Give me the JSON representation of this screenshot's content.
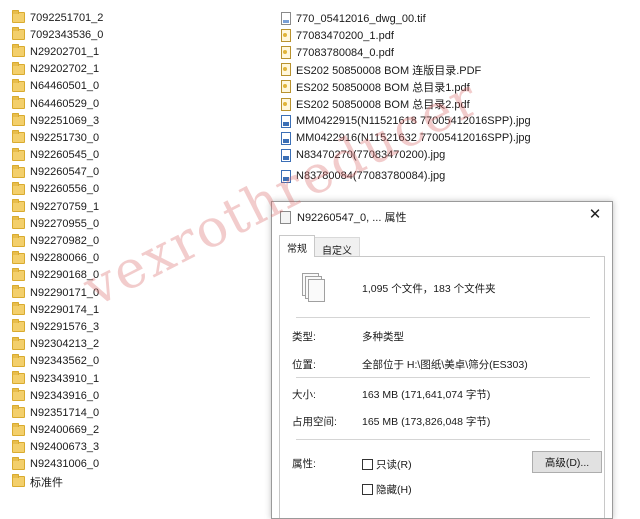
{
  "folders": [
    "7092251701_2",
    "7092343536_0",
    "N29202701_1",
    "N29202702_1",
    "N64460501_0",
    "N64460529_0",
    "N92251069_3",
    "N92251730_0",
    "N92260545_0",
    "N92260547_0",
    "N92260556_0",
    "N92270759_1",
    "N92270955_0",
    "N92270982_0",
    "N92280066_0",
    "N92290168_0",
    "N92290171_0",
    "N92290174_1",
    "N92291576_3",
    "N92304213_2",
    "N92343562_0",
    "N92343910_1",
    "N92343916_0",
    "N92351714_0",
    "N92400669_2",
    "N92400673_3",
    "N92431006_0",
    "标准件"
  ],
  "files": [
    {
      "name": "770_05412016_dwg_00.tif",
      "type": "tif"
    },
    {
      "name": "77083470200_1.pdf",
      "type": "pdf"
    },
    {
      "name": "77083780084_0.pdf",
      "type": "pdf"
    },
    {
      "name": "ES202  50850008 BOM 连版目录.PDF",
      "type": "pdf"
    },
    {
      "name": "ES202  50850008 BOM 总目录1.pdf",
      "type": "pdf"
    },
    {
      "name": "ES202  50850008 BOM 总目录2.pdf",
      "type": "pdf"
    },
    {
      "name": "MM0422915(N11521618 77005412016SPP).jpg",
      "type": "img"
    },
    {
      "name": "MM0422916(N11521632 77005412016SPP).jpg",
      "type": "img"
    },
    {
      "name": "N83470270(77083470200).jpg",
      "type": "img"
    },
    {
      "name": "N83780084(77083780084).jpg",
      "type": "img"
    }
  ],
  "dialog": {
    "title": "N92260547_0, ... 属性",
    "close": "✕",
    "tabs": [
      "常规",
      "自定义"
    ],
    "summary": "1,095 个文件，183 个文件夹",
    "type_label": "类型:",
    "type_value": "多种类型",
    "location_label": "位置:",
    "location_value": "全部位于 H:\\图纸\\美卓\\筛分(ES303)",
    "size_label": "大小:",
    "size_value": "163 MB (171,641,074 字节)",
    "disk_label": "占用空间:",
    "disk_value": "165 MB (173,826,048 字节)",
    "attr_label": "属性:",
    "readonly": "只读(R)",
    "hidden": "隐藏(H)",
    "advanced": "高级(D)..."
  },
  "watermark": "vexrothreducer"
}
